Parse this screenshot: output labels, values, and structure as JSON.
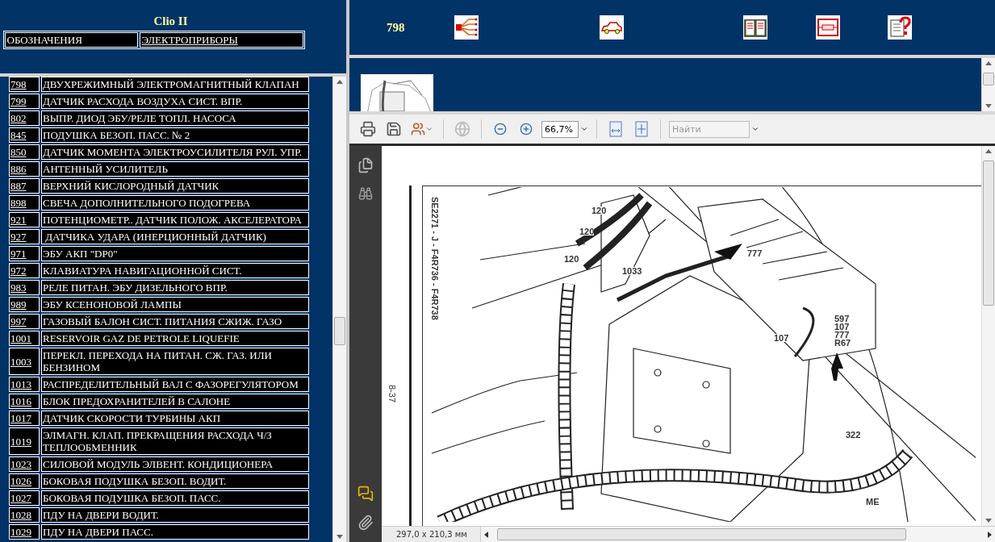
{
  "sidebar": {
    "title": "Clio II",
    "tabs": [
      {
        "label": "ОБОЗНАЧЕНИЯ",
        "kind": "label"
      },
      {
        "label": "ЭЛЕКТРОПРИБОРЫ",
        "kind": "link"
      }
    ],
    "items": [
      {
        "code": "798",
        "name": "ДВУХРЕЖИМНЫЙ ЭЛЕКТРОМАГНИТНЫЙ КЛАПАН"
      },
      {
        "code": "799",
        "name": "ДАТЧИК РАСХОДА ВОЗДУХА СИСТ. ВПР."
      },
      {
        "code": "802",
        "name": "ВЫПР. ДИОД ЭБУ/РЕЛЕ ТОПЛ. НАСОСА"
      },
      {
        "code": "845",
        "name": "ПОДУШКА БЕЗОП. ПАСС. № 2"
      },
      {
        "code": "850",
        "name": "ДАТЧИК МОМЕНТА ЭЛЕКТРОУСИЛИТЕЛЯ РУЛ. УПР."
      },
      {
        "code": "886",
        "name": "АНТЕННЫЙ УСИЛИТЕЛЬ"
      },
      {
        "code": "887",
        "name": "ВЕРХНИЙ КИСЛОРОДНЫЙ ДАТЧИК"
      },
      {
        "code": "898",
        "name": "СВЕЧА ДОПОЛНИТЕЛЬНОГО ПОДОГРЕВА"
      },
      {
        "code": "921",
        "name": "ПОТЕНЦИОМЕТР.. ДАТЧИК ПОЛОЖ. АКСЕЛЕРАТОРА"
      },
      {
        "code": "927",
        "name": " ДАТЧИКА УДАРА (ИНЕРЦИОННЫЙ ДАТЧИК)"
      },
      {
        "code": "971",
        "name": "ЭБУ АКП \"DP0\""
      },
      {
        "code": "972",
        "name": "КЛАВИАТУРА НАВИГАЦИОННОЙ СИСТ."
      },
      {
        "code": "983",
        "name": "РЕЛЕ ПИТАН. ЭБУ ДИЗЕЛЬНОГО ВПР."
      },
      {
        "code": "989",
        "name": "ЭБУ КСЕНОНОВОЙ ЛАМПЫ"
      },
      {
        "code": "997",
        "name": "ГАЗОВЫЙ БАЛОН СИСТ. ПИТАНИЯ СЖИЖ. ГАЗО"
      },
      {
        "code": "1001",
        "name": "RESERVOIR GAZ DE PETROLE LIQUEFIE"
      },
      {
        "code": "1003",
        "name": "ПЕРЕКЛ. ПЕРЕХОДА НА ПИТАН. СЖ. ГАЗ. ИЛИ БЕНЗИНОМ"
      },
      {
        "code": "1013",
        "name": "РАСПРЕДЕЛИТЕЛЬНЫЙ ВАЛ С ФАЗОРЕГУЛЯТОРОМ"
      },
      {
        "code": "1016",
        "name": "БЛОК ПРЕДОХРАНИТЕЛЕЙ В САЛОНЕ"
      },
      {
        "code": "1017",
        "name": "ДАТЧИК СКОРОСТИ ТУРБИНЫ АКП"
      },
      {
        "code": "1019",
        "name": "ЭЛМАГН. КЛАП. ПРЕКРАЩЕНИЯ РАСХОДА Ч/З ТЕПЛООБМЕННИК"
      },
      {
        "code": "1023",
        "name": "СИЛОВОЙ МОДУЛЬ ЭЛВЕНТ. КОНДИЦИОНЕРА"
      },
      {
        "code": "1026",
        "name": "БОКОВАЯ ПОДУШКА БЕЗОП. ВОДИТ."
      },
      {
        "code": "1027",
        "name": "БОКОВАЯ ПОДУШКА БЕЗОП. ПАСС."
      },
      {
        "code": "1028",
        "name": "ПДУ НА ДВЕРИ ВОДИТ."
      },
      {
        "code": "1029",
        "name": "ПДУ НА ДВЕРИ ПАСС."
      }
    ]
  },
  "topbar": {
    "code": "798"
  },
  "pdf_toolbar": {
    "zoom": "66,7%",
    "search": {
      "placeholder": "Найти"
    }
  },
  "document": {
    "side_label": "SE2271 - J - F4R736 - F4R738",
    "page_number": "8-37",
    "callouts": [
      "120",
      "120",
      "120",
      "1033",
      "777",
      "107",
      "597",
      "107",
      "777",
      "R67",
      "322",
      "ME"
    ]
  },
  "status_bar": {
    "page_size": "297,0 x 210,3 мм"
  }
}
